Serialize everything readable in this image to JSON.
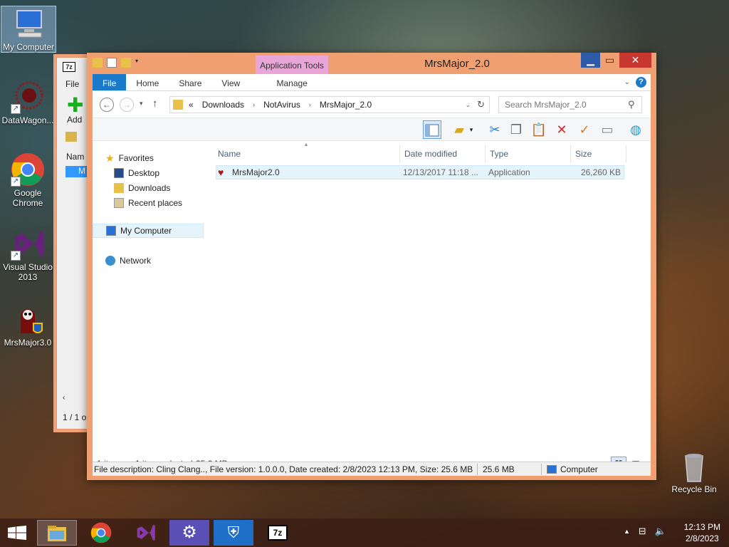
{
  "desktop": {
    "icons": [
      {
        "label": "My Computer"
      },
      {
        "label": "DataWagon..."
      },
      {
        "label": "Google Chrome"
      },
      {
        "label": "Visual Studio 2013"
      },
      {
        "label": "MrsMajor3.0"
      },
      {
        "label": "Recycle Bin"
      }
    ]
  },
  "back_window": {
    "title_icon": "7z",
    "menu_file": "File",
    "add_label": "Add",
    "col_name": "Nam",
    "row": "M",
    "status": "1 / 1 o"
  },
  "explorer": {
    "title": "MrsMajor_2.0",
    "contextual_tab_group": "Application Tools",
    "tabs": [
      "File",
      "Home",
      "Share",
      "View",
      "Manage"
    ],
    "address": {
      "overflow": "«",
      "crumbs": [
        "Downloads",
        "NotAvirus",
        "MrsMajor_2.0"
      ]
    },
    "search_placeholder": "Search MrsMajor_2.0",
    "nav": {
      "favorites": "Favorites",
      "desktop": "Desktop",
      "downloads": "Downloads",
      "recent": "Recent places",
      "computer": "My Computer",
      "network": "Network"
    },
    "columns": {
      "name": "Name",
      "date": "Date modified",
      "type": "Type",
      "size": "Size"
    },
    "files": [
      {
        "name": "MrsMajor2.0",
        "date": "12/13/2017 11:18 ...",
        "type": "Application",
        "size": "26,260 KB"
      }
    ],
    "status": {
      "count": "1 item",
      "selected": "1 item selected",
      "selected_size": "25.6 MB"
    },
    "infobar": {
      "description": "File description: Cling Clang.., File version: 1.0.0.0, Date created: 2/8/2023 12:13 PM, Size: 25.6 MB",
      "size": "25.6 MB",
      "location": "Computer"
    }
  },
  "taskbar": {
    "time": "12:13 PM",
    "date": "2/8/2023"
  },
  "colors": {
    "window_frame": "#f0a070",
    "file_tab": "#1979ca",
    "close_button": "#c7372f",
    "contextual_tab": "#e9a6d8"
  }
}
